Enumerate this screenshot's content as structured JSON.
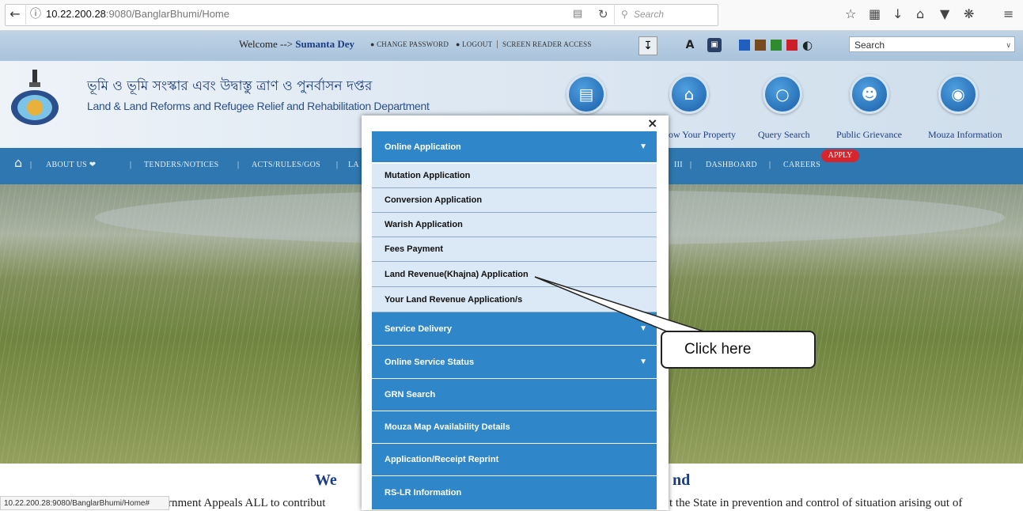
{
  "browser": {
    "url_host": "10.22.200.28",
    "url_path": ":9080/BanglarBhumi/Home",
    "search_placeholder": "Search"
  },
  "topbar": {
    "welcome_prefix": "Welcome --> ",
    "user_name": "Sumanta Dey",
    "change_password": "CHANGE PASSWORD",
    "logout": "LOGOUT",
    "screen_reader": "SCREEN READER ACCESS",
    "font_a": "A",
    "search_value": "Search"
  },
  "header": {
    "title_bn": "ভূমি ও ভূমি সংস্কার এবং উদ্বাস্তু ত্রাণ ও পুনর্বাসন দপ্তর",
    "title_en": "Land & Land Reforms and Refugee Relief and Rehabilitation Department",
    "icons": [
      {
        "label": "",
        "icon": "id-card-icon"
      },
      {
        "label": "ow Your Property",
        "icon": "home-icon"
      },
      {
        "label": "Query Search",
        "icon": "chat-icon"
      },
      {
        "label": "Public Grievance",
        "icon": "people-icon"
      },
      {
        "label": "Mouza Information",
        "icon": "globe-icon"
      }
    ]
  },
  "nav": {
    "items": [
      "ABOUT US",
      "TENDERS/NOTICES",
      "ACTS/RULES/GOS",
      "LA",
      "III",
      "DASHBOARD",
      "CAREERS"
    ],
    "apply_badge": "APPLY"
  },
  "modal": {
    "close": "×",
    "items": [
      {
        "label": "Online Application",
        "style": "blue",
        "chevron": true
      },
      {
        "label": "Mutation Application",
        "style": "sub"
      },
      {
        "label": "Conversion Application",
        "style": "sub"
      },
      {
        "label": "Warish Application",
        "style": "sub"
      },
      {
        "label": "Fees Payment",
        "style": "sub"
      },
      {
        "label": "Land Revenue(Khajna) Application",
        "style": "sub"
      },
      {
        "label": "Your Land Revenue Application/s",
        "style": "sub"
      },
      {
        "label": "Service Delivery",
        "style": "blue",
        "chevron": true
      },
      {
        "label": "Online Service Status",
        "style": "blue",
        "chevron": true
      },
      {
        "label": "GRN Search",
        "style": "blue"
      },
      {
        "label": "Mouza Map Availability Details",
        "style": "blue"
      },
      {
        "label": "Application/Receipt Reprint",
        "style": "blue"
      },
      {
        "label": "RS-LR Information",
        "style": "blue"
      }
    ]
  },
  "callout": {
    "text": "Click here"
  },
  "welcome": {
    "title_left": "We",
    "title_right": "nd",
    "body_left": "rnment Appeals ALL to contribut",
    "body_right": "t the State in prevention and control of situation arising out of"
  },
  "statusbar": "10.22.200.28:9080/BanglarBhumi/Home#",
  "colors": {
    "nav_blue": "#2e77b0",
    "menu_blue": "#2f86c8",
    "menu_sub": "#dbe8f5",
    "apply_red": "#d7252b",
    "theme_squares": [
      "#1f5fbf",
      "#7a4a1f",
      "#2e8b2e",
      "#cc1f2a"
    ]
  }
}
